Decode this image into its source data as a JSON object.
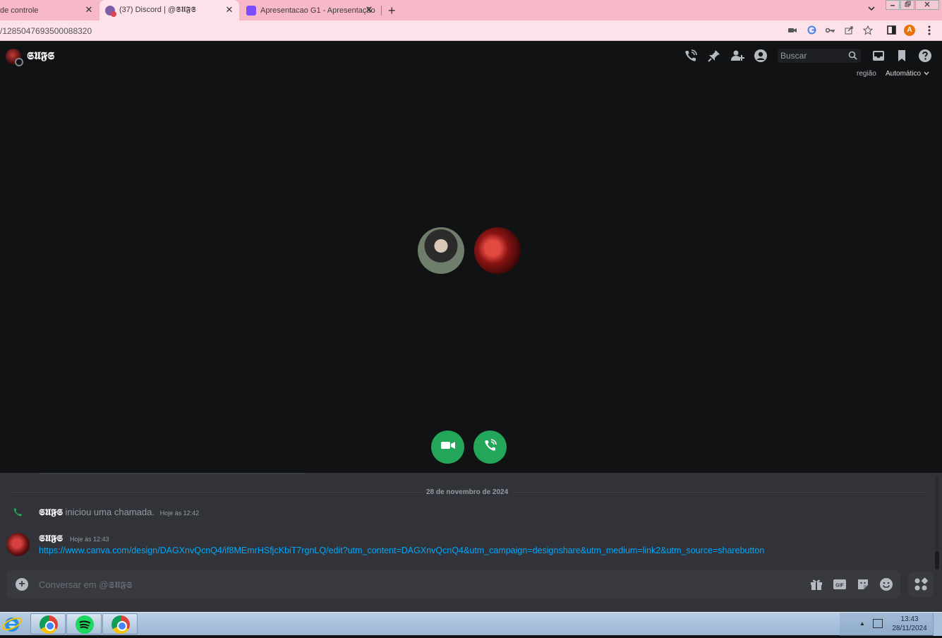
{
  "browser": {
    "tabs": [
      {
        "title": "de controle"
      },
      {
        "title": "(37) Discord | @𝕾𝖀𝕱𝕾",
        "active": true
      },
      {
        "title": "Apresentacao G1 - Apresentação"
      }
    ],
    "new_tab_symbol": "+",
    "close_symbol": "✕",
    "url": "/1285047693500088320",
    "profile_initial": "A"
  },
  "discord": {
    "dm_name": "𝕾𝖀𝕱𝕾",
    "search_placeholder": "Buscar",
    "region_label": "região",
    "region_value": "Automático",
    "date_divider": "28 de novembro de 2024",
    "system_message": {
      "author": "𝕾𝖀𝕱𝕾",
      "text": "iniciou uma chamada.",
      "timestamp": "Hoje às 12:42"
    },
    "message": {
      "author": "𝕾𝖀𝕱𝕾",
      "timestamp": "Hoje às 12:43",
      "link": "https://www.canva.com/design/DAGXnvQcnQ4/if8MEmrHSfjcKbiT7rgnLQ/edit?utm_content=DAGXnvQcnQ4&utm_campaign=designshare&utm_medium=link2&utm_source=sharebutton"
    },
    "composer_placeholder": "Conversar em @𝕾𝖀𝕱𝕾",
    "gif_label": "GIF",
    "accent_green": "#23a55a",
    "link_color": "#00a8fc"
  },
  "taskbar": {
    "time": "13:43",
    "date": "28/11/2024"
  }
}
